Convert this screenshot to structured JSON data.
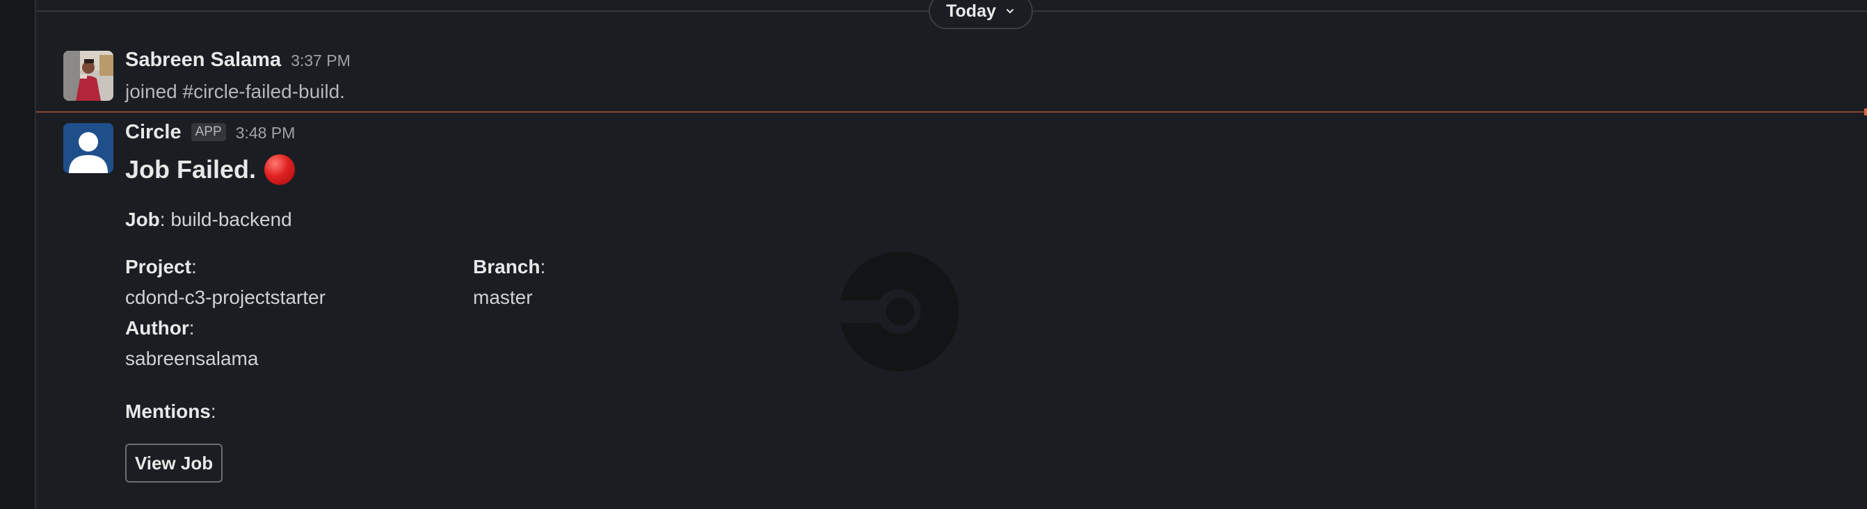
{
  "date_divider": {
    "label": "Today"
  },
  "messages": [
    {
      "sender": "Sabreen Salama",
      "time": "3:37 PM",
      "text": "joined #circle-failed-build."
    },
    {
      "sender": "Circle",
      "badge": "APP",
      "time": "3:48 PM",
      "title": "Job Failed.",
      "job_label": "Job",
      "job_value": "build-backend",
      "project_label": "Project",
      "project_value": "cdond-c3-projectstarter",
      "branch_label": "Branch",
      "branch_value": "master",
      "author_label": "Author",
      "author_value": "sabreensalama",
      "mentions_label": "Mentions",
      "button_label": "View Job"
    }
  ],
  "colors": {
    "background": "#1a1d21",
    "new_messages_line": "#8a4a33",
    "failed_dot": "#e02020",
    "app_avatar": "#1f4f8b"
  },
  "icons": {
    "date_chevron": "chevron-down-icon",
    "status": "red-circle-icon",
    "app_logo_watermark": "circleci-logo-icon"
  }
}
